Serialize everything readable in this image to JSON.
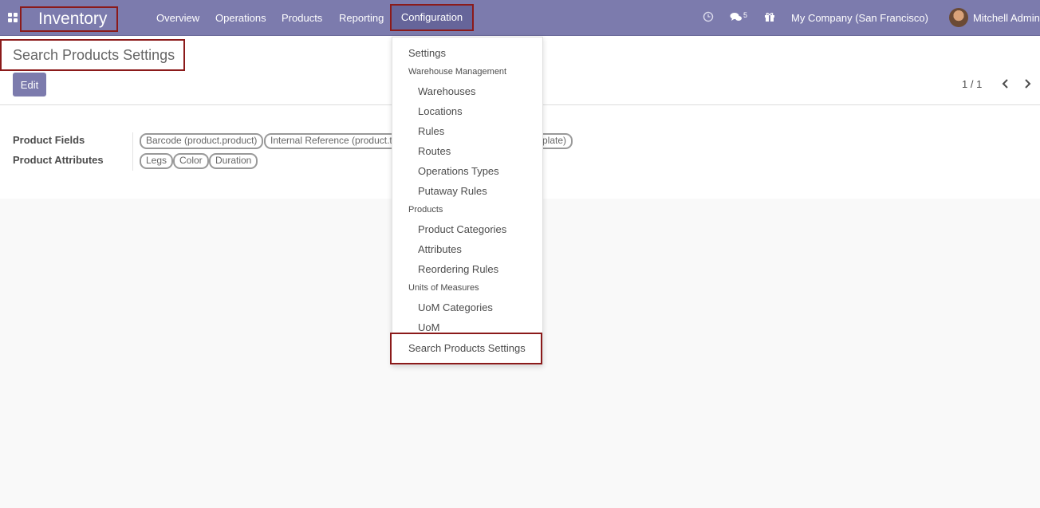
{
  "navbar": {
    "brand": "Inventory",
    "menu": [
      "Overview",
      "Operations",
      "Products",
      "Reporting"
    ],
    "active_menu": "Configuration",
    "messages_count": "5",
    "company": "My Company (San Francisco)",
    "user": "Mitchell Admin",
    "bg_color": "#7c7bad",
    "icons": [
      "apps-icon",
      "clock-icon",
      "chat-icon",
      "gift-icon",
      "avatar"
    ]
  },
  "control_panel": {
    "breadcrumb": "Search Products Settings",
    "edit_label": "Edit",
    "pager": "1 / 1"
  },
  "form": {
    "product_fields_label": "Product Fields",
    "product_attributes_label": "Product Attributes",
    "product_fields": [
      "Barcode (product.product)",
      "Internal Reference (product.t",
      "mplate)"
    ],
    "product_attributes": [
      "Legs",
      "Color",
      "Duration"
    ]
  },
  "dropdown": {
    "settings": "Settings",
    "group_warehouse": "Warehouse Management",
    "warehouse_items": [
      "Warehouses",
      "Locations",
      "Rules",
      "Routes",
      "Operations Types",
      "Putaway Rules"
    ],
    "group_products": "Products",
    "product_items": [
      "Product Categories",
      "Attributes",
      "Reordering Rules"
    ],
    "group_uom": "Units of Measures",
    "uom_items": [
      "UoM Categories",
      "UoM"
    ],
    "highlighted_item": "Search Products Settings"
  }
}
